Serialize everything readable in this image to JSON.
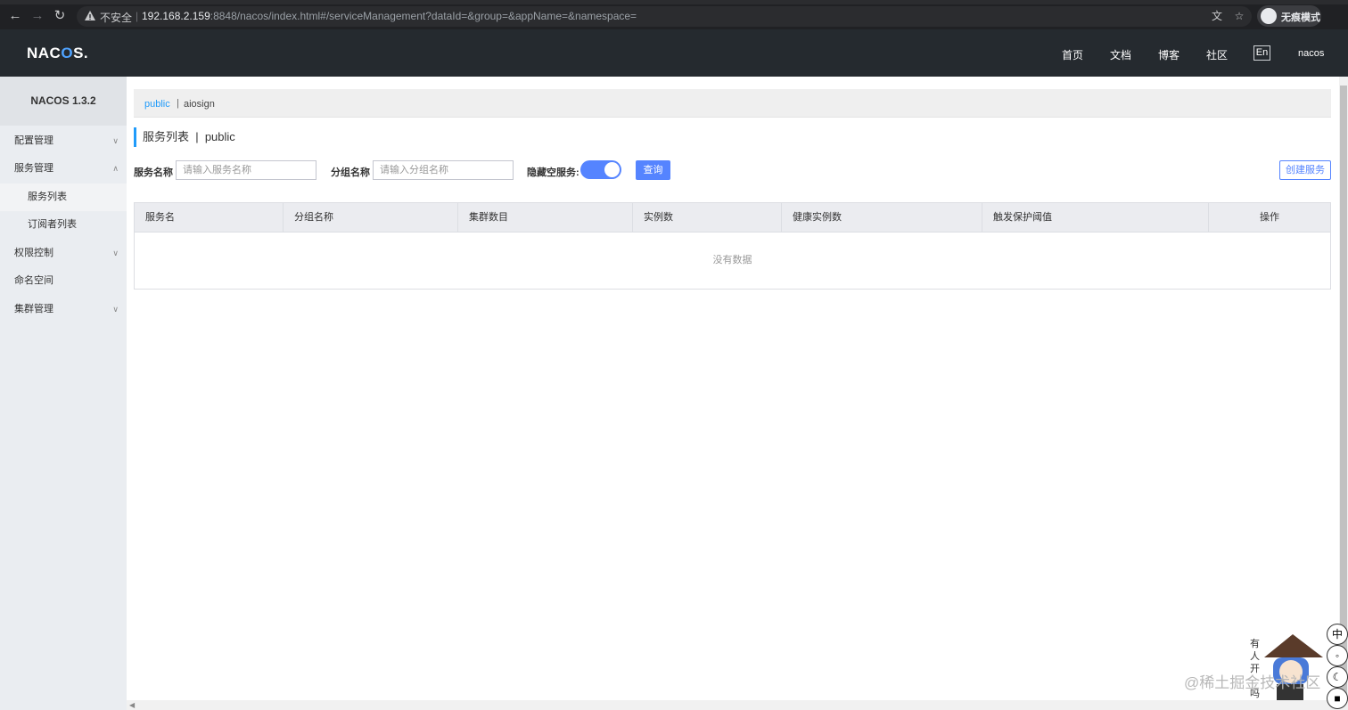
{
  "browser": {
    "security_label": "不安全",
    "url_host": "192.168.2.159",
    "url_rest": ":8848/nacos/index.html#/serviceManagement?dataId=&group=&appName=&namespace=",
    "incognito_label": "无痕模式"
  },
  "header": {
    "logo_prefix": "NAC",
    "logo_o": "O",
    "logo_suffix": "S.",
    "nav": [
      "首页",
      "文档",
      "博客",
      "社区"
    ],
    "lang": "En",
    "user": "nacos"
  },
  "sidebar": {
    "title": "NACOS 1.3.2",
    "items": [
      {
        "label": "配置管理"
      },
      {
        "label": "服务管理"
      },
      {
        "label": "服务列表"
      },
      {
        "label": "订阅者列表"
      },
      {
        "label": "权限控制"
      },
      {
        "label": "命名空间"
      },
      {
        "label": "集群管理"
      }
    ]
  },
  "namespaces": {
    "active": "public",
    "divider": "|",
    "other": "aiosign"
  },
  "page": {
    "title": "服务列表  |  public"
  },
  "filters": {
    "service_label": "服务名称",
    "service_placeholder": "请输入服务名称",
    "group_label": "分组名称",
    "group_placeholder": "请输入分组名称",
    "hide_empty_label": "隐藏空服务:",
    "hide_empty_on": true,
    "query_label": "查询",
    "create_label": "创建服务"
  },
  "table": {
    "columns": [
      "服务名",
      "分组名称",
      "集群数目",
      "实例数",
      "健康实例数",
      "触发保护阈值",
      "操作"
    ],
    "empty_text": "没有数据"
  },
  "watermark": "@稀土掘金技术社区",
  "float_buttons": [
    "中"
  ],
  "colors": {
    "accent": "#5584ff",
    "link": "#209bfa",
    "header_bg": "#252a2f",
    "sidebar_bg": "#eaedf1"
  }
}
